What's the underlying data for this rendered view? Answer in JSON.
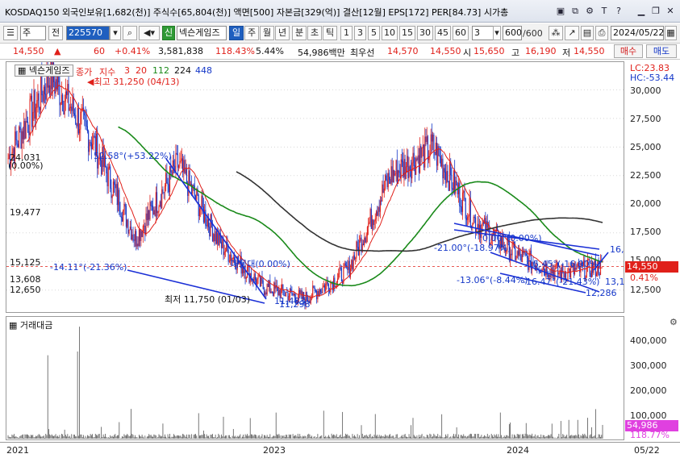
{
  "titlebar": {
    "title": "KOSDAQ150 외국인보유[1,682(천)] 주식수[65,804(천)] 액면[500] 자본금[329(억)] 결산[12월] EPS[172] PER[84.73] 시가총",
    "icons": [
      "window-icon",
      "clone-icon",
      "settings-icon",
      "T-icon",
      "help-icon",
      "minimize-icon",
      "restore-icon",
      "close-icon"
    ]
  },
  "toolbar": {
    "period_type": "주",
    "prev_label": "전",
    "stock_code": "225570",
    "stock_name": "넥슨게임즈",
    "sin_label": "신",
    "periods": [
      "일",
      "주",
      "월",
      "년",
      "분",
      "초",
      "틱"
    ],
    "active_period": "일",
    "intervals": [
      "1",
      "3",
      "5",
      "10",
      "15",
      "30",
      "45",
      "60"
    ],
    "interval_value": "3",
    "count": "600",
    "count_total": "/600",
    "date": "2024/05/22"
  },
  "quote": {
    "price": "14,550",
    "change": "60",
    "change_pct": "+0.41%",
    "volume": "3,581,838",
    "volume_ratio": "118.43%",
    "turnover": "5.44%",
    "amount": "54,986백만",
    "best_label": "최우선",
    "best_ask": "14,570",
    "best_bid": "14,550",
    "open_label": "시",
    "open": "15,650",
    "high_label": "고",
    "high": "16,190",
    "low_label": "저",
    "low": "14,550",
    "buy_label": "매수",
    "sell_label": "매도"
  },
  "price_panel": {
    "name_tag": "넥슨게임즈",
    "legend": [
      "종가",
      "지수",
      "3",
      "20",
      "112",
      "224",
      "448"
    ],
    "lc": "LC:23.83",
    "hc": "HC:-53.44",
    "current_price_tag": "14,550",
    "current_pct_tag": "0.41%",
    "y_ticks": [
      "30,000",
      "27,500",
      "25,000",
      "22,500",
      "20,000",
      "17,500",
      "15,000",
      "12,500"
    ],
    "left_prices": [
      "24,031",
      "19,477",
      "15,125",
      "13,608",
      "12,650"
    ],
    "left_pct": "(0.00%)",
    "high_note": "최고 31,250 (04/13)",
    "low_note": "최저 11,750 (01/03)",
    "annotations": [
      "52.58°(+53.22%)",
      "-14.11°(-21.36%)",
      "매물대(0.00%)",
      "-21.00°(-18.97%)",
      "0.00°(0.00%)",
      "-13.06°(-8.44%)",
      "-16.47°(-21.43%)",
      "-15.45°(-16.90%)",
      "11,298",
      "11,483",
      "12,286",
      "16,",
      "13,1"
    ]
  },
  "volume_panel": {
    "title": "거래대금",
    "y_ticks": [
      "400,000",
      "300,000",
      "200,000",
      "100,000",
      "0"
    ],
    "value_tag": "54,986",
    "pct_tag": "118.77%"
  },
  "date_axis": {
    "labels": [
      "2021",
      "2023",
      "2024"
    ],
    "right_label": "05/22"
  },
  "chart_data": {
    "type": "line",
    "ylim": [
      11000,
      32000
    ],
    "x_labels": [
      "2021",
      "2023",
      "2024",
      "05/22"
    ],
    "series": [
      {
        "name": "종가",
        "x": [
          "2021-01",
          "2021-04",
          "2021-07",
          "2021-10",
          "2022-01",
          "2022-04",
          "2022-07",
          "2022-10",
          "2023-01",
          "2023-04",
          "2023-07",
          "2023-10",
          "2024-01",
          "2024-03",
          "2024-05"
        ],
        "values": [
          24031,
          31250,
          25500,
          17000,
          23500,
          16500,
          12800,
          11750,
          14200,
          22500,
          25000,
          18500,
          15500,
          14000,
          14550
        ]
      }
    ],
    "volume": {
      "name": "거래대금",
      "max_visible": 460000,
      "last": 54986
    }
  }
}
